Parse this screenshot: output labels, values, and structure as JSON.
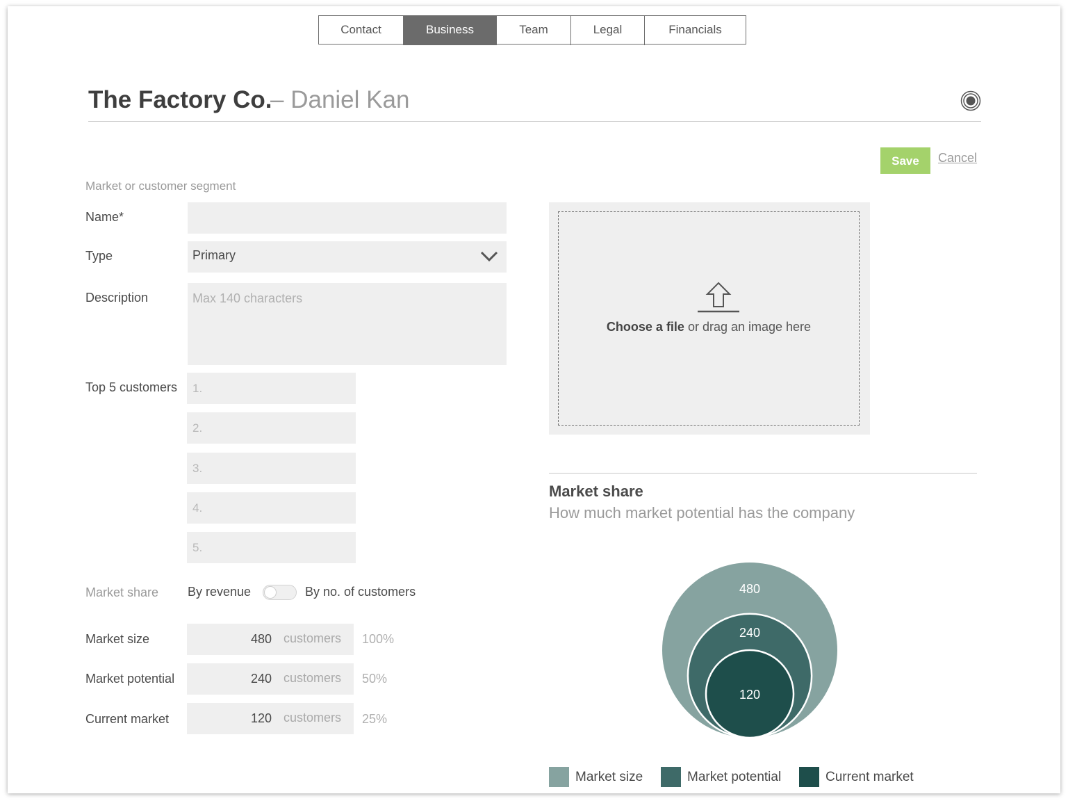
{
  "tabs": [
    {
      "label": "Contact",
      "active": false
    },
    {
      "label": "Business",
      "active": true
    },
    {
      "label": "Team",
      "active": false
    },
    {
      "label": "Legal",
      "active": false
    },
    {
      "label": "Financials",
      "active": false
    }
  ],
  "header": {
    "company": "The Factory Co.",
    "dash": "–",
    "person": "Daniel Kan"
  },
  "actions": {
    "save": "Save",
    "cancel": "Cancel"
  },
  "form": {
    "section_label": "Market or customer segment",
    "name_label": "Name*",
    "name_value": "",
    "type_label": "Type",
    "type_value": "Primary",
    "description_label": "Description",
    "description_placeholder": "Max 140 characters",
    "customers_label": "Top 5 customers",
    "customers": [
      "1.",
      "2.",
      "3.",
      "4.",
      "5."
    ]
  },
  "market_share": {
    "label": "Market share",
    "toggle_left": "By revenue",
    "toggle_right": "By no. of customers",
    "rows": [
      {
        "label": "Market size",
        "value": "480",
        "unit": "customers",
        "pct": "100%"
      },
      {
        "label": "Market potential",
        "value": "240",
        "unit": "customers",
        "pct": "50%"
      },
      {
        "label": "Current market",
        "value": "120",
        "unit": "customers",
        "pct": "25%"
      }
    ]
  },
  "upload": {
    "bold": "Choose a file",
    "rest": " or drag an image here"
  },
  "colors": {
    "accent_save": "#a4d26b",
    "market_size": "#86a3a0",
    "market_potential": "#3e6a68",
    "current_market": "#1e4e4b"
  },
  "chart_data": {
    "type": "bubble",
    "title": "Market share",
    "subtitle": "How much market potential has the company",
    "series": [
      {
        "name": "Market size",
        "value": 480
      },
      {
        "name": "Market potential",
        "value": 240
      },
      {
        "name": "Current market",
        "value": 120
      }
    ],
    "legend": "bottom"
  }
}
